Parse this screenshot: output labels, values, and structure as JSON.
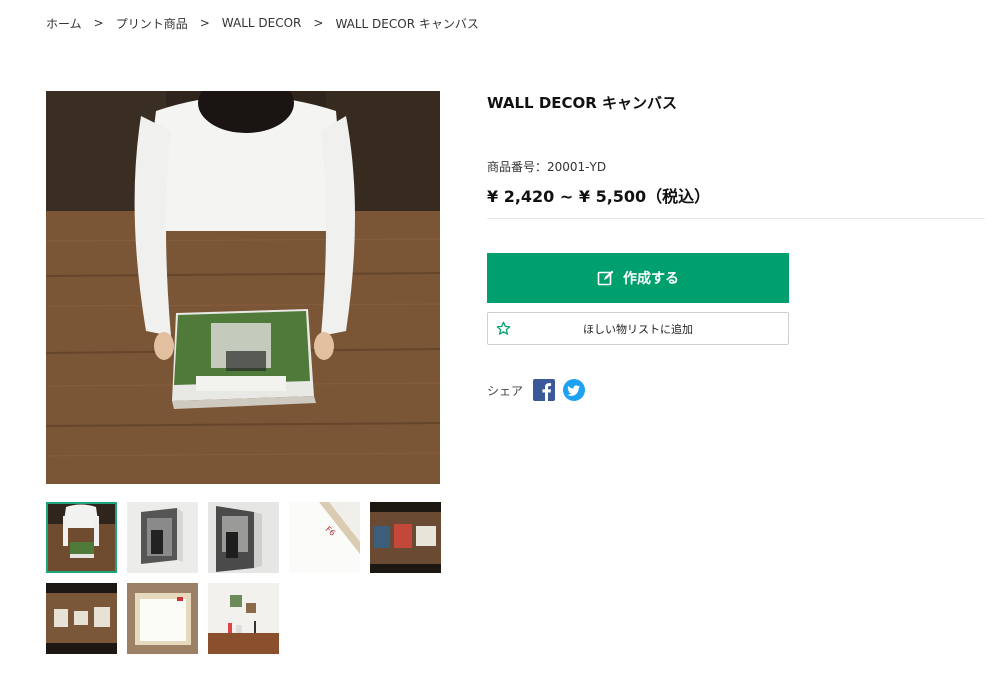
{
  "breadcrumb": {
    "items": [
      "ホーム",
      "プリント商品",
      "WALL DECOR",
      "WALL DECOR キャンバス"
    ],
    "separator": ">"
  },
  "product": {
    "title": "WALL DECOR キャンバス",
    "code": "商品番号：20001-YD",
    "price": "¥ 2,420 ~ ¥ 5,500（税込）"
  },
  "actions": {
    "create_label": "作成する",
    "wishlist_label": "ほしい物リストに追加"
  },
  "share": {
    "label": "シェア",
    "icons": [
      "facebook-icon",
      "twitter-icon"
    ]
  },
  "thumbnails": {
    "selected_index": 0,
    "count": 8
  },
  "colors": {
    "accent": "#00a06e",
    "facebook": "#3b5998",
    "twitter": "#1da1f2"
  }
}
